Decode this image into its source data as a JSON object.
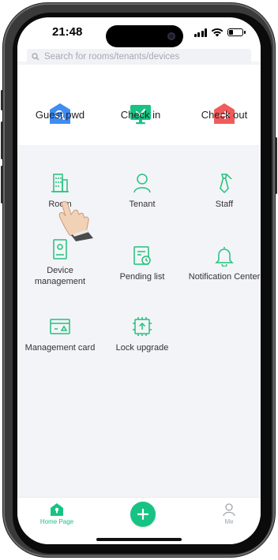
{
  "status_bar": {
    "time": "21:48"
  },
  "search": {
    "placeholder": "Search for rooms/tenants/devices"
  },
  "quick_actions": [
    {
      "label": "Guest pwd",
      "icon": "search-lock-icon",
      "color": "#3f8cf3"
    },
    {
      "label": "Check in",
      "icon": "monitor-check-icon",
      "color": "#17c383"
    },
    {
      "label": "Check out",
      "icon": "arrow-exit-icon",
      "color": "#f25b5b"
    }
  ],
  "grid": {
    "items": [
      {
        "label": "Room",
        "icon": "building-icon"
      },
      {
        "label": "Tenant",
        "icon": "person-icon"
      },
      {
        "label": "Staff",
        "icon": "tie-icon"
      },
      {
        "label": "Device management",
        "icon": "device-icon"
      },
      {
        "label": "Pending list",
        "icon": "clipboard-clock-icon"
      },
      {
        "label": "Notification Center",
        "icon": "bell-icon"
      },
      {
        "label": "Management card",
        "icon": "card-icon"
      },
      {
        "label": "Lock upgrade",
        "icon": "chip-upgrade-icon"
      }
    ]
  },
  "tab_bar": {
    "items": [
      {
        "label": "Home Page",
        "active": true
      },
      {
        "label": "Me",
        "active": false
      }
    ],
    "add_button_icon": "plus-icon"
  },
  "colors": {
    "accent": "#17c383",
    "muted_icon": "#9ea3ad",
    "grid_icon": "#22c27a"
  }
}
